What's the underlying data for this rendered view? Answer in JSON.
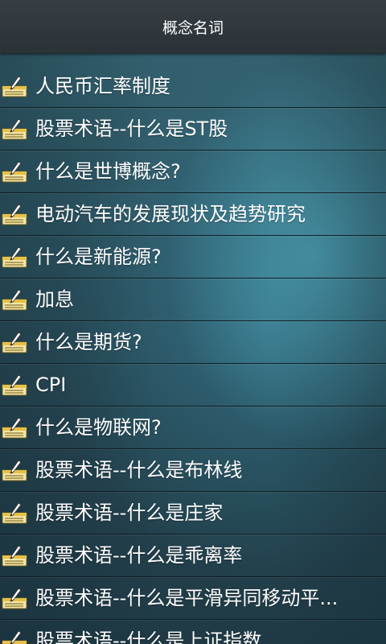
{
  "header": {
    "title": "概念名词"
  },
  "list": {
    "icon": "note-pencil-icon",
    "items": [
      {
        "label": "人民币汇率制度"
      },
      {
        "label": "股票术语--什么是ST股"
      },
      {
        "label": "什么是世博概念?"
      },
      {
        "label": "电动汽车的发展现状及趋势研究"
      },
      {
        "label": "什么是新能源?"
      },
      {
        "label": "加息"
      },
      {
        "label": "什么是期货?"
      },
      {
        "label": "CPI"
      },
      {
        "label": "什么是物联网?"
      },
      {
        "label": "股票术语--什么是布林线"
      },
      {
        "label": "股票术语--什么是庄家"
      },
      {
        "label": "股票术语--什么是乖离率"
      },
      {
        "label": "股票术语--什么是平滑异同移动平..."
      },
      {
        "label": "股票术语--什么是上证指数"
      }
    ]
  }
}
